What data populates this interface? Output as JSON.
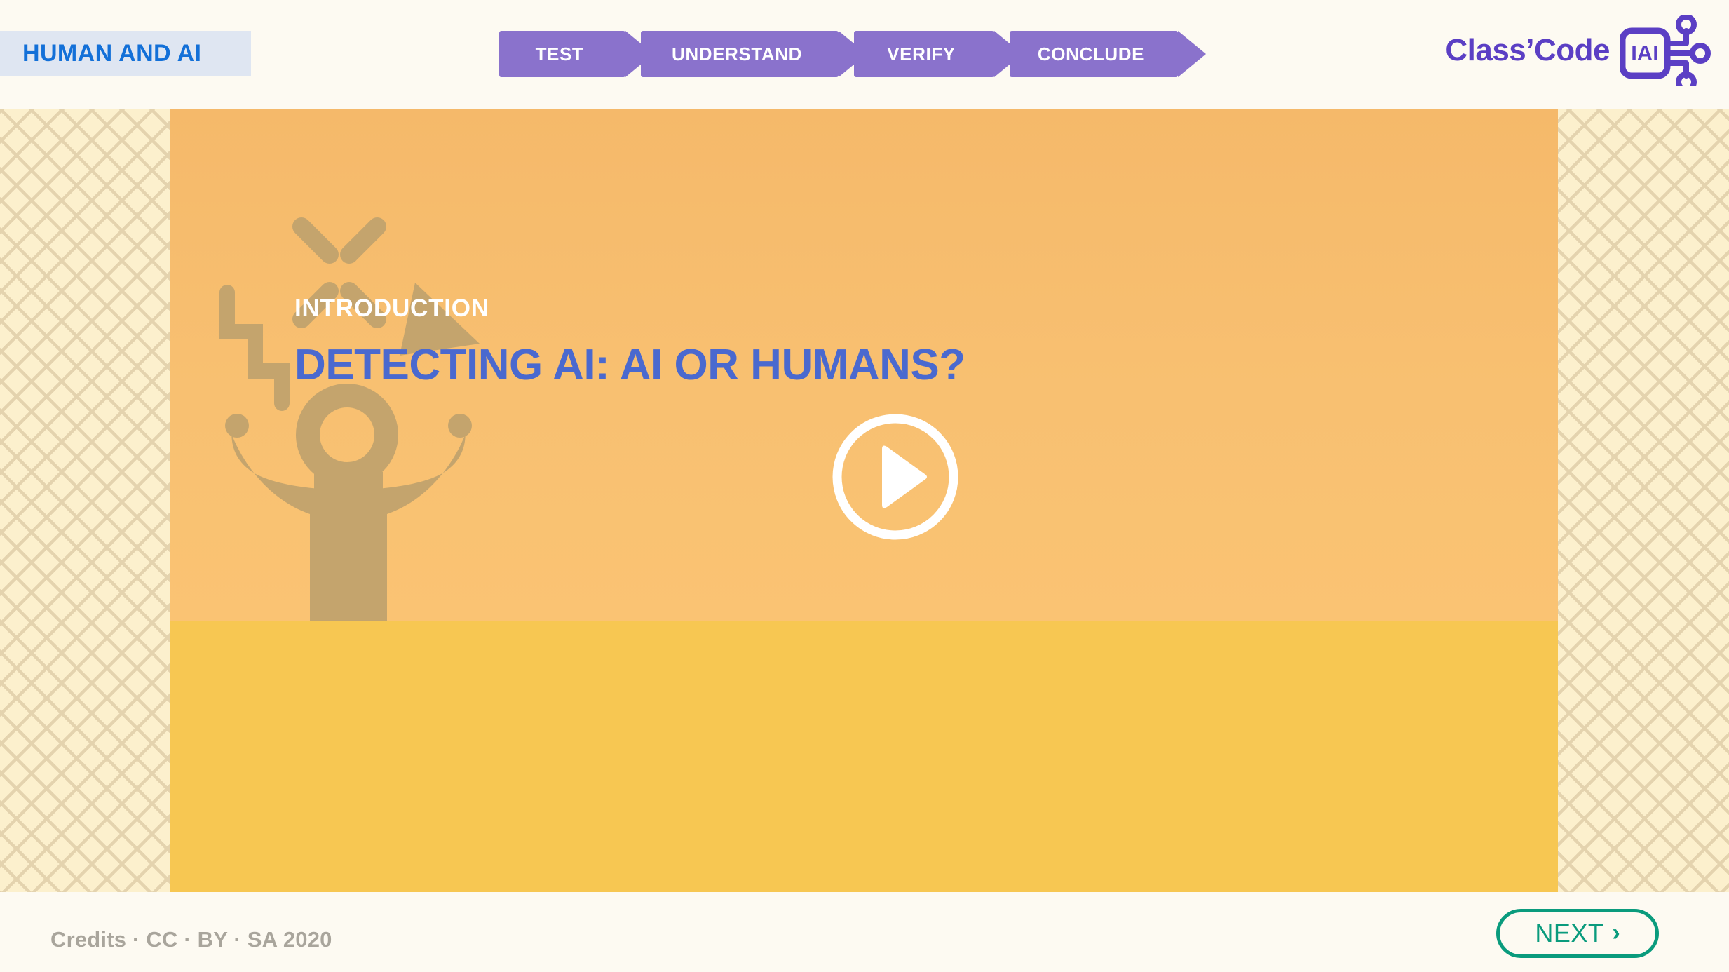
{
  "header": {
    "topic_badge": "HUMAN AND AI",
    "topic_badge_bg": "#dfe6f2",
    "topic_badge_color": "#1370d8",
    "steps": [
      {
        "label": "TEST"
      },
      {
        "label": "UNDERSTAND"
      },
      {
        "label": "VERIFY"
      },
      {
        "label": "CONCLUDE"
      }
    ],
    "step_color": "#8a72cc",
    "logo": {
      "wordmark": "Class’Code",
      "chip_text": "IAI",
      "color": "#5b3fc4"
    }
  },
  "main": {
    "eyebrow": "INTRODUCTION",
    "title": "DETECTING AI: AI OR HUMANS?",
    "title_color": "#4a69cf",
    "video_bg": "#f8c071",
    "caption_bg": "#f7c752",
    "play_label": "play-video",
    "illustration_color": "#c4a46d"
  },
  "background": {
    "pattern_bg": "#fceab7",
    "pattern_mark": "#d6bc86"
  },
  "footer": {
    "credits": "Credits · CC · BY · SA 2020",
    "next_label": "NEXT",
    "next_chevron": "›",
    "next_color": "#0a9b7d"
  }
}
